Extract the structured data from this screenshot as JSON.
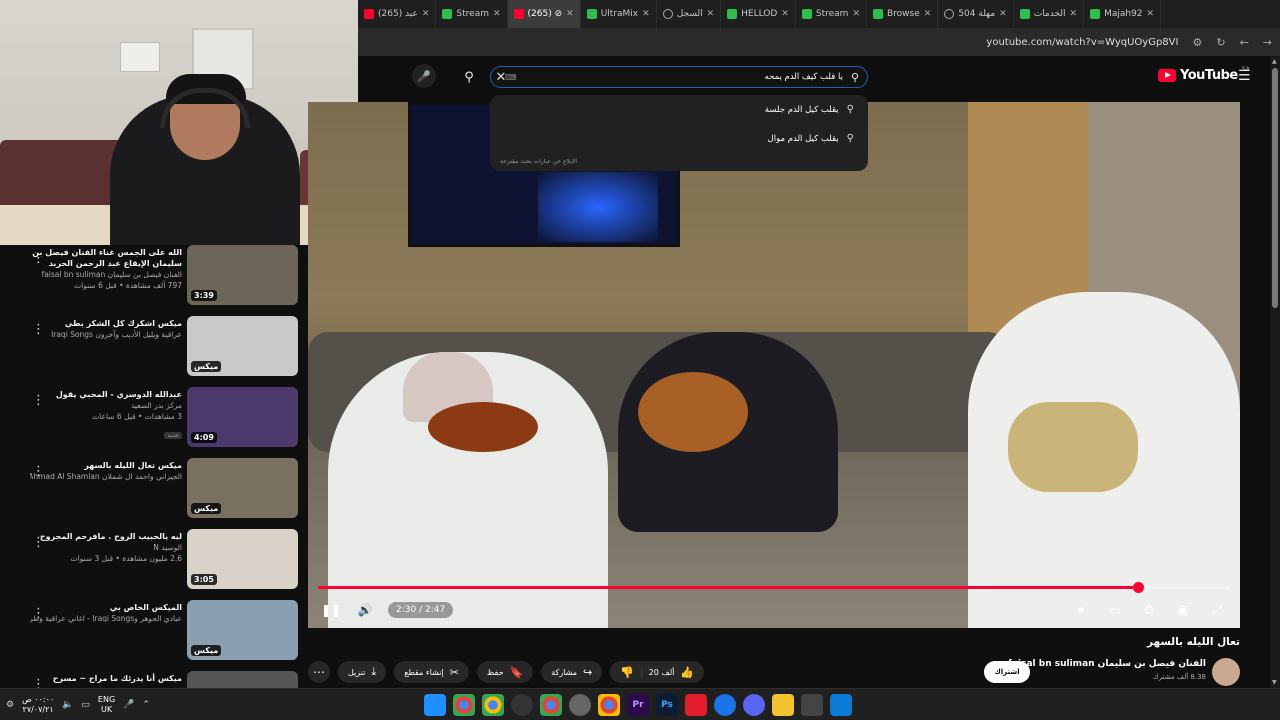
{
  "browser": {
    "tabs": [
      {
        "label": "(265) عبد",
        "fav": "red",
        "active": false
      },
      {
        "label": "Stream",
        "fav": "green",
        "active": false
      },
      {
        "label": "(265) ⊘",
        "fav": "red",
        "active": true
      },
      {
        "label": "UltraMix",
        "fav": "green",
        "active": false
      },
      {
        "label": "السجل",
        "fav": "history",
        "active": false
      },
      {
        "label": "HELLOD",
        "fav": "green",
        "active": false
      },
      {
        "label": "Stream",
        "fav": "green",
        "active": false
      },
      {
        "label": "Browse",
        "fav": "green",
        "active": false
      },
      {
        "label": "504 مهلة",
        "fav": "circ",
        "active": false
      },
      {
        "label": "الخدمات",
        "fav": "green",
        "active": false
      },
      {
        "label": "Majah92",
        "fav": "green",
        "active": false
      }
    ],
    "url": "youtube.com/watch?v=WyqUOyGp8VI"
  },
  "youtube": {
    "logo": "YouTube",
    "country": "SA",
    "search_query": "يا قلب كيف الدم يمحه",
    "suggestions": [
      "يقلب كيل الدم جلسة",
      "يقلب كيل الدم موال"
    ],
    "report_link": "الإبلاغ عن عبارات بحث مقترحة"
  },
  "sidebar": {
    "items": [
      {
        "title": "الله على الجمس غناء الفنان فيصل بن سليمان الإيقاع عبد الرحمن الحربد",
        "channel": "الفنان فيصل بن سليمان faisal bn suliman",
        "meta": "797 ألف مشاهدة • قبل 6 سنوات",
        "duration": "3:39",
        "new": ""
      },
      {
        "title": "ميكس اشكرك كل الشكر بطي",
        "channel": "عراقية ويليل الأديب وآخرون Iraqi Songs",
        "meta": "",
        "duration": "ميكس",
        "new": ""
      },
      {
        "title": "عبدالله الدوسري - المحبي يقول",
        "channel": "مركز بدر السعيد",
        "meta": "3 مشاهدات • قبل 6 ساعات",
        "duration": "4:09",
        "new": "جديد"
      },
      {
        "title": "ميكس تعال الليله بالسهر",
        "channel": "الجيزاني واحمد ال شملان Ahmad Al Shamlan",
        "meta": "",
        "duration": "ميكس",
        "new": ""
      },
      {
        "title": "ليه يالحبيب الروح . مافرحم المجروح",
        "channel": "الوسيد N",
        "meta": "2.6 مليون مشاهدة • قبل 3 سنوات",
        "duration": "3:05",
        "new": ""
      },
      {
        "title": "الميكس الخاص بي",
        "channel": "عبادي الجوهر وIraqi Songs - اغاني عراقية وطرب",
        "meta": "",
        "duration": "ميكس",
        "new": ""
      },
      {
        "title": "ميكس أنا يدرئك ما مراح ~ مسرح",
        "channel": "",
        "meta": "",
        "duration": "",
        "new": ""
      }
    ]
  },
  "player": {
    "time": "2:30 / 2:47",
    "progress": 0.899
  },
  "video": {
    "title": "تعال الليله بالسهر",
    "channel": "الفنان فيصل بن سليمان faisal bn suliman",
    "subscribers": "8.38 ألف مشترك",
    "subscribe_label": "اشتراك",
    "likes": "20 ألف",
    "share_label": "مشاركة",
    "save_label": "حفظ",
    "clip_label": "إنشاء مقطع",
    "download_label": "تنزيل"
  },
  "taskbar": {
    "time": "٠٠:٠٠ ص",
    "date": "٢٧/٠٧/٢١",
    "lang": "ENG",
    "region": "UK"
  }
}
